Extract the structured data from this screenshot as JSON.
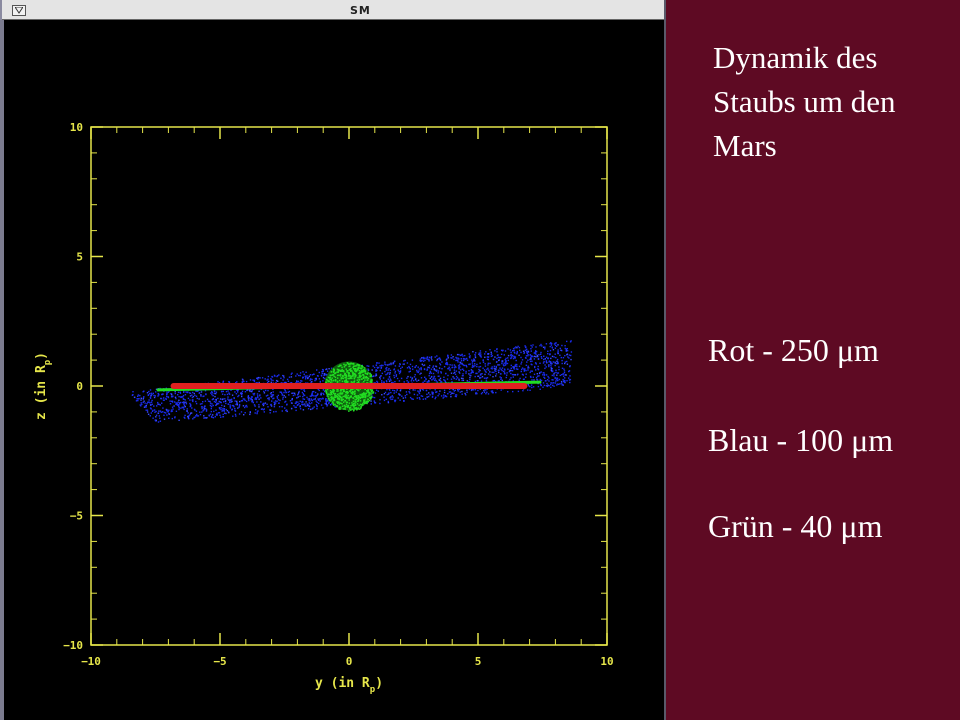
{
  "window": {
    "title": "SM"
  },
  "slide": {
    "title": "Dynamik des Staubs um den Mars",
    "legend": [
      {
        "text": "Rot - 250 μm",
        "color": "#e02020"
      },
      {
        "text": "Blau - 100 μm",
        "color": "#1a2cf0"
      },
      {
        "text": "Grün - 40 μm",
        "color": "#22dd22"
      }
    ]
  },
  "chart_data": {
    "type": "scatter",
    "title": "",
    "xlabel": "y (in Rp)",
    "ylabel": "z (in Rp)",
    "xlim": [
      -10,
      10
    ],
    "ylim": [
      -10,
      10
    ],
    "xticks": [
      -10,
      -5,
      0,
      5,
      10
    ],
    "yticks": [
      -10,
      -5,
      0,
      5,
      10
    ],
    "axis_color": "#e6e64a",
    "grid": false,
    "series": [
      {
        "color": "#1a2cf0",
        "shape": "tilted band",
        "polygon": [
          [
            -8.5,
            -0.2
          ],
          [
            8.6,
            1.8
          ],
          [
            8.6,
            0.1
          ],
          [
            7.5,
            -0.1
          ],
          [
            -7.5,
            -1.4
          ],
          [
            -8.5,
            -0.3
          ]
        ]
      },
      {
        "color": "#22dd22",
        "shape": "disk",
        "center": [
          0,
          0
        ],
        "radius": 0.95
      },
      {
        "color": "#22dd22",
        "shape": "line",
        "from": [
          -7.4,
          -0.15
        ],
        "to": [
          7.4,
          0.15
        ]
      },
      {
        "color": "#e02020",
        "shape": "line",
        "from": [
          -6.8,
          0.0
        ],
        "to": [
          6.8,
          0.0
        ]
      }
    ]
  }
}
